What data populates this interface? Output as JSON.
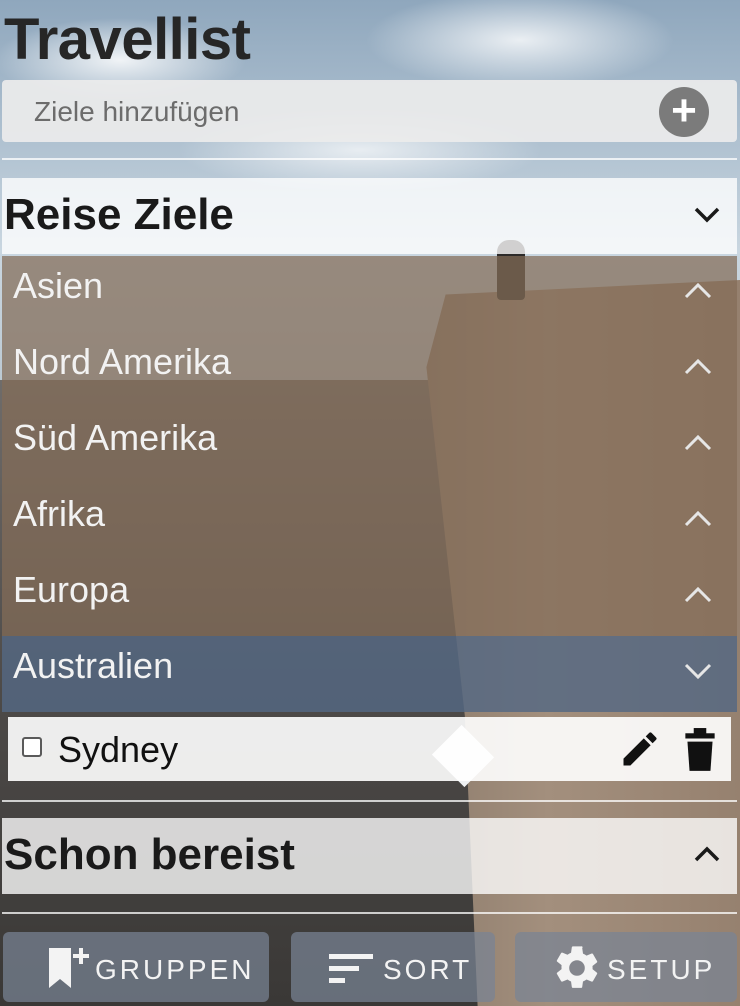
{
  "app": {
    "title": "Travellist"
  },
  "add_bar": {
    "placeholder": "Ziele hinzufügen",
    "add_icon": "plus-circle-icon"
  },
  "sections": {
    "reise_ziele": {
      "title": "Reise Ziele",
      "state": "expanded"
    },
    "schon_bereist": {
      "title": "Schon bereist",
      "state": "collapsed"
    }
  },
  "groups": [
    {
      "label": "Asien",
      "state": "collapsed"
    },
    {
      "label": "Nord Amerika",
      "state": "collapsed"
    },
    {
      "label": "Süd Amerika",
      "state": "collapsed"
    },
    {
      "label": "Afrika",
      "state": "collapsed"
    },
    {
      "label": "Europa",
      "state": "collapsed"
    },
    {
      "label": "Australien",
      "state": "expanded"
    }
  ],
  "items": [
    {
      "label": "Sydney",
      "checked": false,
      "actions": [
        "edit-icon",
        "trash-icon"
      ]
    }
  ],
  "toolbar": {
    "gruppen_label": "GRUPPEN",
    "sort_label": "SORT",
    "setup_label": "SETUP"
  },
  "colors": {
    "group_bg": "#836c58",
    "active_group_bg": "#546882",
    "toolbar_bg": "#788494"
  }
}
